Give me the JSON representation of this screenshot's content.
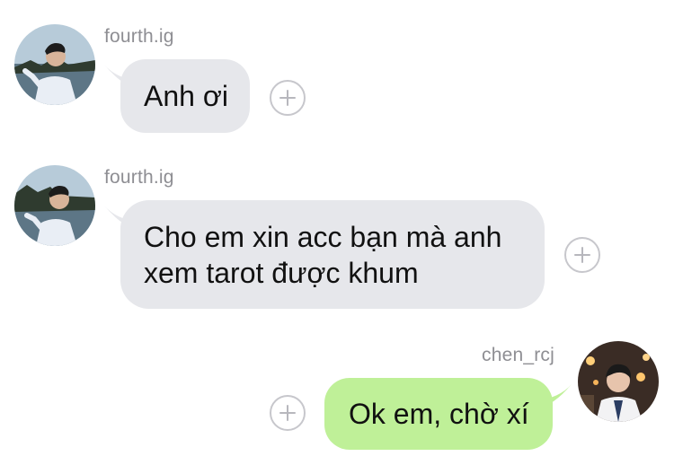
{
  "messages": [
    {
      "sender": "fourth.ig",
      "direction": "incoming",
      "text": "Anh ơi"
    },
    {
      "sender": "fourth.ig",
      "direction": "incoming",
      "lines": [
        "Cho em xin acc bạn mà anh",
        "xem tarot được khum"
      ]
    },
    {
      "sender": "chen_rcj",
      "direction": "outgoing",
      "text": "Ok em, chờ xí"
    }
  ],
  "colors": {
    "incoming_bubble": "#e6e7eb",
    "outgoing_bubble": "#bff098",
    "username": "#8e8e93",
    "message_text": "#111111"
  },
  "icons": {
    "reaction": "add-reaction-icon"
  }
}
